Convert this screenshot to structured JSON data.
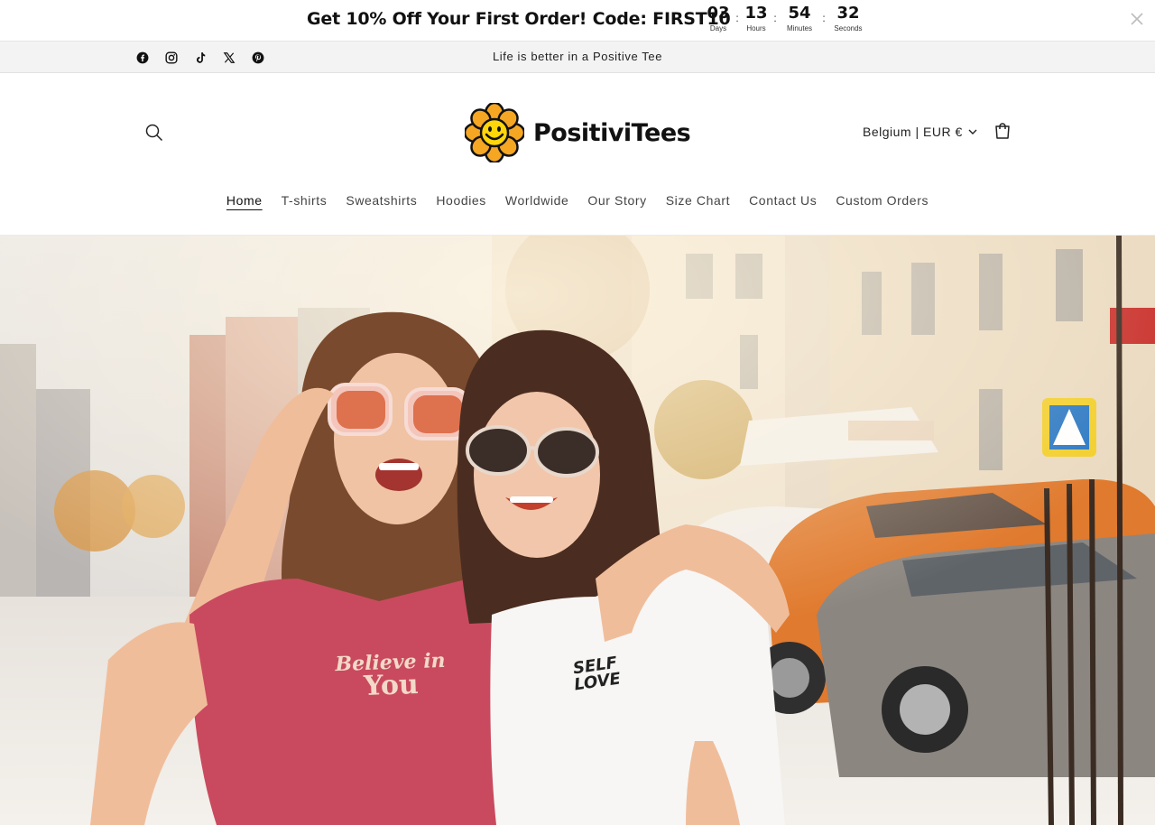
{
  "promo": {
    "text": "Get 10% Off Your First Order! Code: FIRST10",
    "countdown": [
      {
        "value": "03",
        "label": "Days"
      },
      {
        "value": "13",
        "label": "Hours"
      },
      {
        "value": "54",
        "label": "Minutes"
      },
      {
        "value": "32",
        "label": "Seconds"
      }
    ],
    "separator": ":",
    "close_icon": "close-icon"
  },
  "announcement": {
    "text": "Life is better in a Positive Tee",
    "socials": [
      "facebook-icon",
      "instagram-icon",
      "tiktok-icon",
      "x-icon",
      "pinterest-icon"
    ]
  },
  "header": {
    "logo_text": "PositiviTees",
    "locale": "Belgium | EUR €",
    "search_icon": "search-icon",
    "cart_icon": "cart-icon"
  },
  "nav": {
    "items": [
      "Home",
      "T-shirts",
      "Sweatshirts",
      "Hoodies",
      "Worldwide",
      "Our Story",
      "Size Chart",
      "Contact Us",
      "Custom Orders"
    ],
    "active": "Home"
  },
  "hero": {
    "shirt_left_text_1": "Believe in",
    "shirt_left_text_2": "You",
    "shirt_right_text_1": "SELF",
    "shirt_right_text_2": "LOVE"
  },
  "colors": {
    "logo_flower": "#f5a623",
    "logo_face": "#ffd60a",
    "shirt_left": "#c94a5e",
    "car_orange": "#e07a2e"
  }
}
